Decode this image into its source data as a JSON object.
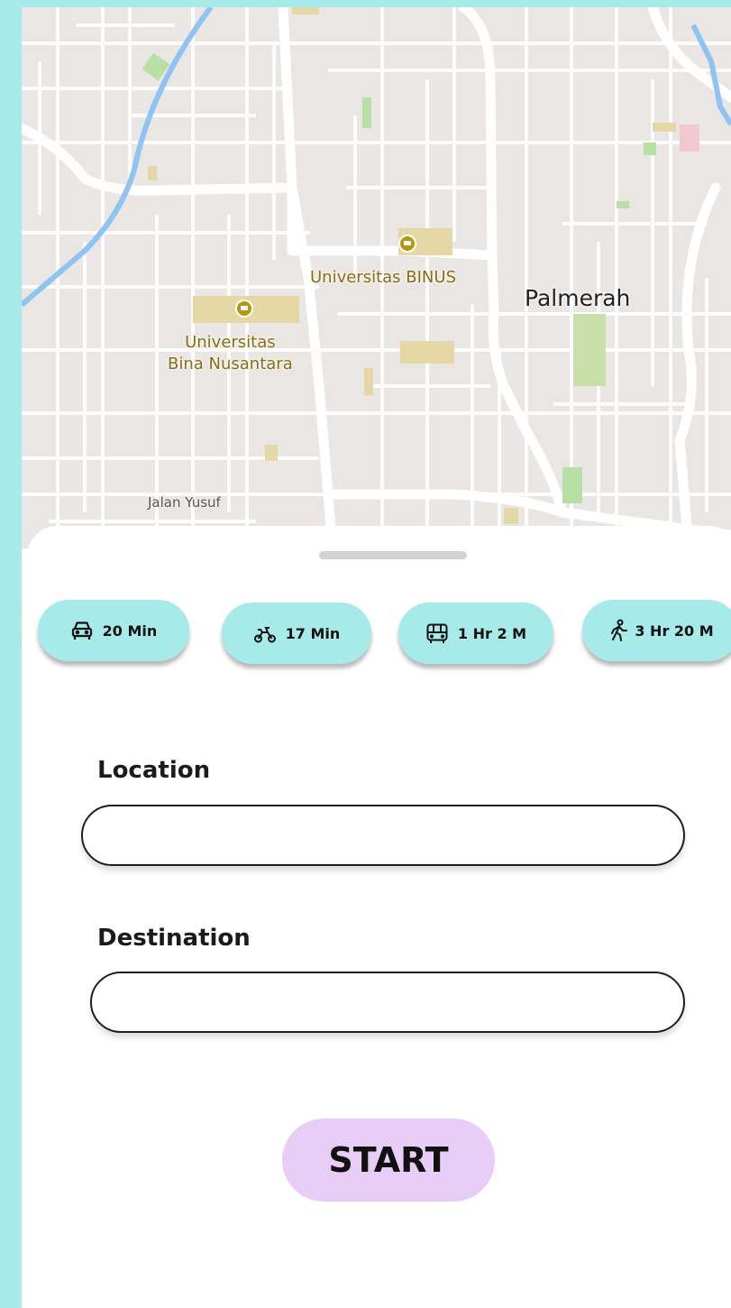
{
  "map": {
    "poi_binus": "Universitas BINUS",
    "poi_bina_nusantara": [
      "Universitas",
      "Bina Nusantara"
    ],
    "district": "Palmerah",
    "street": "Jalan Yusuf"
  },
  "transport_modes": [
    {
      "mode": "car",
      "icon": "car-icon",
      "time": "20 Min"
    },
    {
      "mode": "motorbike",
      "icon": "motorbike-icon",
      "time": "17 Min"
    },
    {
      "mode": "bus",
      "icon": "bus-icon",
      "time": "1 Hr 2 M"
    },
    {
      "mode": "walk",
      "icon": "walking-icon",
      "time": "3 Hr 20 M"
    }
  ],
  "form": {
    "location_label": "Location",
    "location_value": "",
    "destination_label": "Destination",
    "destination_value": "",
    "start_label": "START"
  },
  "colors": {
    "background": "#a6ebe9",
    "chip": "#a6ebe9",
    "start_button": "#e8cef7"
  }
}
